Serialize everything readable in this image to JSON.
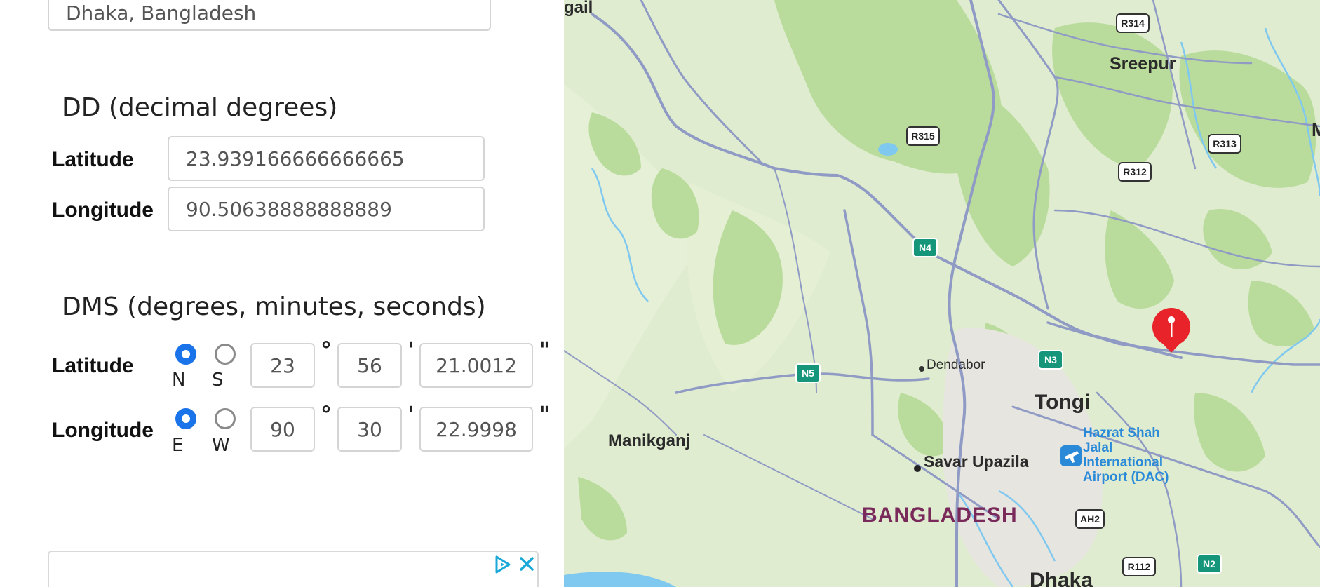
{
  "location": {
    "value": "Dhaka, Bangladesh"
  },
  "dd": {
    "title": "DD (decimal degrees)",
    "lat_label": "Latitude",
    "lat_value": "23.939166666666665",
    "lng_label": "Longitude",
    "lng_value": "90.50638888888889"
  },
  "dms": {
    "title": "DMS (degrees, minutes, seconds)",
    "lat": {
      "label": "Latitude",
      "dir1": "N",
      "dir2": "S",
      "selected": "N",
      "deg": "23",
      "min": "56",
      "sec": "21.0012"
    },
    "lng": {
      "label": "Longitude",
      "dir1": "E",
      "dir2": "W",
      "selected": "E",
      "deg": "90",
      "min": "30",
      "sec": "22.9998"
    },
    "deg_symbol": "°",
    "min_symbol": "'",
    "sec_symbol": "\""
  },
  "map": {
    "places": {
      "sreepur": "Sreepur",
      "dendabor": "Dendabor",
      "tongi": "Tongi",
      "manikganj": "Manikganj",
      "savar": "Savar Upazila",
      "bangladesh": "BANGLADESH",
      "dhaka": "Dhaka",
      "gail": "gail",
      "m_edge": "M",
      "airport_1": "Hazrat Shah",
      "airport_2": "Jalal",
      "airport_3": "International",
      "airport_4": "Airport (DAC)"
    },
    "shields": {
      "r314": "R314",
      "r315": "R315",
      "r313": "R313",
      "r312": "R312",
      "ah2": "AH2",
      "r112": "R112",
      "n4": "N4",
      "n5": "N5",
      "n3": "N3",
      "n2": "N2"
    },
    "colors": {
      "land": "#dfeccf",
      "forest": "#b9dc9c",
      "road": "#8f9bc4",
      "water": "#7fc8ef",
      "highway_shield": "#15967a",
      "pin": "#e8232a",
      "country_label": "#7a2a5a",
      "airport": "#2a8ad8"
    }
  },
  "ad": {
    "icon_play": "ad-choices-icon",
    "icon_close": "close-icon"
  }
}
